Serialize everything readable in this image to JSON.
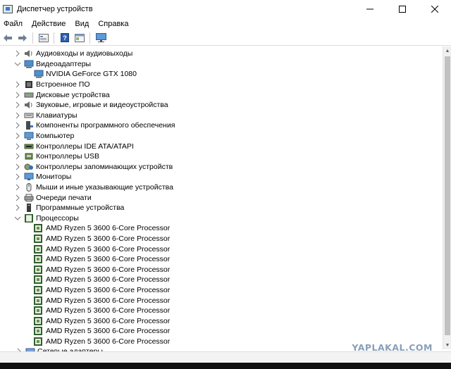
{
  "window": {
    "title": "Диспетчер устройств",
    "controls": [
      "minimize",
      "maximize",
      "close"
    ]
  },
  "menu": [
    "Файл",
    "Действие",
    "Вид",
    "Справка"
  ],
  "toolbar": {
    "buttons": [
      "back-arrow-icon",
      "forward-arrow-icon",
      "properties-icon",
      "help-icon",
      "show-hidden-icon",
      "monitor-scan-icon"
    ]
  },
  "tree": {
    "categories": [
      {
        "label": "Аудиовходы и аудиовыходы",
        "expanded": false,
        "icon": "speaker-icon"
      },
      {
        "label": "Видеоадаптеры",
        "expanded": true,
        "icon": "display-adapter-icon",
        "children": [
          "NVIDIA GeForce GTX 1080"
        ]
      },
      {
        "label": "Встроенное ПО",
        "expanded": false,
        "icon": "firmware-icon"
      },
      {
        "label": "Дисковые устройства",
        "expanded": false,
        "icon": "disk-icon"
      },
      {
        "label": "Звуковые, игровые и видеоустройства",
        "expanded": false,
        "icon": "speaker-icon"
      },
      {
        "label": "Клавиатуры",
        "expanded": false,
        "icon": "keyboard-icon"
      },
      {
        "label": "Компоненты программного обеспечения",
        "expanded": false,
        "icon": "software-component-icon"
      },
      {
        "label": "Компьютер",
        "expanded": false,
        "icon": "computer-icon"
      },
      {
        "label": "Контроллеры IDE ATA/ATAPI",
        "expanded": false,
        "icon": "ide-controller-icon"
      },
      {
        "label": "Контроллеры USB",
        "expanded": false,
        "icon": "usb-icon"
      },
      {
        "label": "Контроллеры запоминающих устройств",
        "expanded": false,
        "icon": "storage-controller-icon"
      },
      {
        "label": "Мониторы",
        "expanded": false,
        "icon": "monitor-icon"
      },
      {
        "label": "Мыши и иные указывающие устройства",
        "expanded": false,
        "icon": "mouse-icon"
      },
      {
        "label": "Очереди печати",
        "expanded": false,
        "icon": "printer-icon"
      },
      {
        "label": "Программные устройства",
        "expanded": false,
        "icon": "software-device-icon"
      },
      {
        "label": "Процессоры",
        "expanded": true,
        "icon": "processor-icon",
        "children": [
          "AMD Ryzen 5 3600 6-Core Processor",
          "AMD Ryzen 5 3600 6-Core Processor",
          "AMD Ryzen 5 3600 6-Core Processor",
          "AMD Ryzen 5 3600 6-Core Processor",
          "AMD Ryzen 5 3600 6-Core Processor",
          "AMD Ryzen 5 3600 6-Core Processor",
          "AMD Ryzen 5 3600 6-Core Processor",
          "AMD Ryzen 5 3600 6-Core Processor",
          "AMD Ryzen 5 3600 6-Core Processor",
          "AMD Ryzen 5 3600 6-Core Processor",
          "AMD Ryzen 5 3600 6-Core Processor",
          "AMD Ryzen 5 3600 6-Core Processor"
        ]
      }
    ],
    "partial_last": "Сетевые адаптеры"
  },
  "watermark": "YAPLAKAL.COM",
  "colors": {
    "chevron": "#7a7a7a",
    "processor_icon": "#2f5f2f",
    "watermark": "#8aa0b8"
  }
}
